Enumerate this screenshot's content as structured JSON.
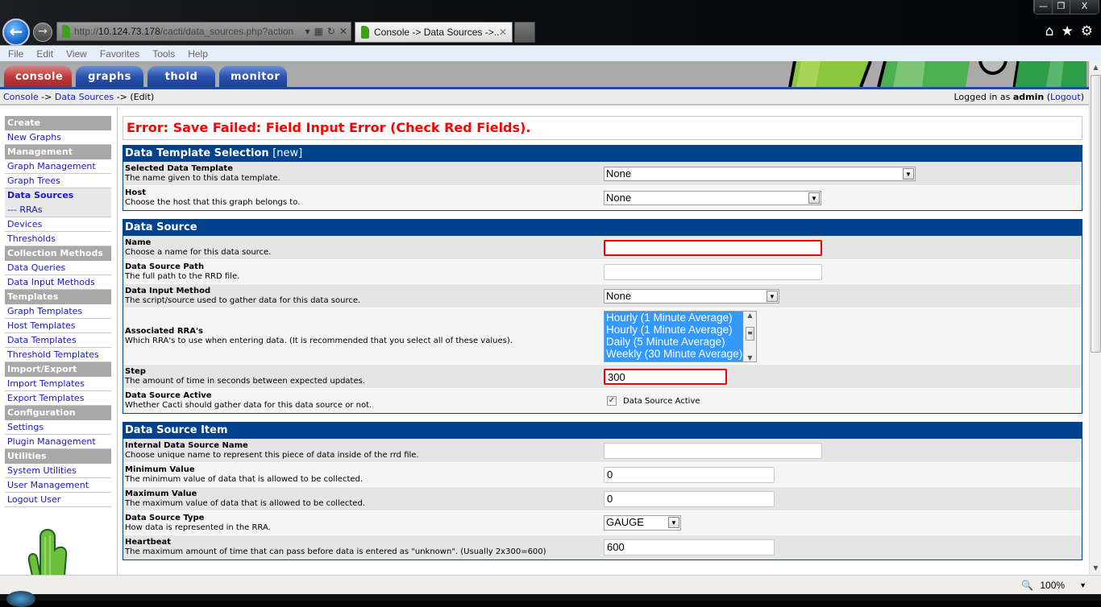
{
  "browser": {
    "address_prefix": "http://",
    "address_host": "10.124.73.178",
    "address_path": "/cacti/data_sources.php?action",
    "tab_title": "Console -> Data Sources ->...",
    "window_controls": [
      "—",
      "❐",
      "X"
    ],
    "toolbar_icons": [
      "home-icon",
      "favorites-star-icon",
      "tools-gear-icon"
    ],
    "menu": [
      "File",
      "Edit",
      "View",
      "Favorites",
      "Tools",
      "Help"
    ],
    "zoom_level": "100%"
  },
  "header": {
    "tabs": [
      {
        "label": "console",
        "active": true
      },
      {
        "label": "graphs",
        "active": false
      },
      {
        "label": "thold",
        "active": false
      },
      {
        "label": "monitor",
        "active": false
      }
    ]
  },
  "breadcrumb": {
    "items": [
      "Console",
      "Data Sources",
      "(Edit)"
    ],
    "separator": " -> "
  },
  "login": {
    "prefix": "Logged in as ",
    "user": "admin",
    "logout": "Logout"
  },
  "sidebar": {
    "sections": [
      {
        "title": "Create",
        "items": [
          {
            "label": "New Graphs"
          }
        ]
      },
      {
        "title": "Management",
        "items": [
          {
            "label": "Graph Management"
          },
          {
            "label": "Graph Trees"
          },
          {
            "label": "Data Sources",
            "active": true
          },
          {
            "label": "--- RRAs",
            "active": true
          },
          {
            "label": "Devices"
          },
          {
            "label": "Thresholds"
          }
        ]
      },
      {
        "title": "Collection Methods",
        "items": [
          {
            "label": "Data Queries"
          },
          {
            "label": "Data Input Methods"
          }
        ]
      },
      {
        "title": "Templates",
        "items": [
          {
            "label": "Graph Templates"
          },
          {
            "label": "Host Templates"
          },
          {
            "label": "Data Templates"
          },
          {
            "label": "Threshold Templates"
          }
        ]
      },
      {
        "title": "Import/Export",
        "items": [
          {
            "label": "Import Templates"
          },
          {
            "label": "Export Templates"
          }
        ]
      },
      {
        "title": "Configuration",
        "items": [
          {
            "label": "Settings"
          },
          {
            "label": "Plugin Management"
          }
        ]
      },
      {
        "title": "Utilities",
        "items": [
          {
            "label": "System Utilities"
          },
          {
            "label": "User Management"
          },
          {
            "label": "Logout User"
          }
        ]
      }
    ]
  },
  "error_message": "Error: Save Failed: Field Input Error (Check Red Fields).",
  "sections": {
    "template": {
      "title": "Data Template Selection",
      "subtitle": "[new]",
      "fields": {
        "selected_template": {
          "label": "Selected Data Template",
          "desc": "The name given to this data template.",
          "value": "None"
        },
        "host": {
          "label": "Host",
          "desc": "Choose the host that this graph belongs to.",
          "value": "None"
        }
      }
    },
    "data_source": {
      "title": "Data Source",
      "fields": {
        "name": {
          "label": "Name",
          "desc": "Choose a name for this data source.",
          "value": "",
          "error": true
        },
        "path": {
          "label": "Data Source Path",
          "desc": "The full path to the RRD file.",
          "value": ""
        },
        "input_method": {
          "label": "Data Input Method",
          "desc": "The script/source used to gather data for this data source.",
          "value": "None"
        },
        "rras": {
          "label": "Associated RRA's",
          "desc": "Which RRA's to use when entering data. (It is recommended that you select all of these values).",
          "options": [
            "Hourly (1 Minute Average)",
            "Hourly (1 Minute Average)",
            "Daily (5 Minute Average)",
            "Weekly (30 Minute Average)"
          ]
        },
        "step": {
          "label": "Step",
          "desc": "The amount of time in seconds between expected updates.",
          "value": "300",
          "error": true
        },
        "active": {
          "label": "Data Source Active",
          "desc": "Whether Cacti should gather data for this data source or not.",
          "checkbox_label": "Data Source Active",
          "checked": true
        }
      }
    },
    "item": {
      "title": "Data Source Item",
      "fields": {
        "internal_name": {
          "label": "Internal Data Source Name",
          "desc": "Choose unique name to represent this piece of data inside of the rrd file.",
          "value": ""
        },
        "min": {
          "label": "Minimum Value",
          "desc": "The minimum value of data that is allowed to be collected.",
          "value": "0"
        },
        "max": {
          "label": "Maximum Value",
          "desc": "The maximum value of data that is allowed to be collected.",
          "value": "0"
        },
        "type": {
          "label": "Data Source Type",
          "desc": "How data is represented in the RRA.",
          "value": "GAUGE"
        },
        "heartbeat": {
          "label": "Heartbeat",
          "desc": "The maximum amount of time that can pass before data is entered as \"unknown\". (Usually 2x300=600)",
          "value": "600"
        }
      }
    }
  }
}
